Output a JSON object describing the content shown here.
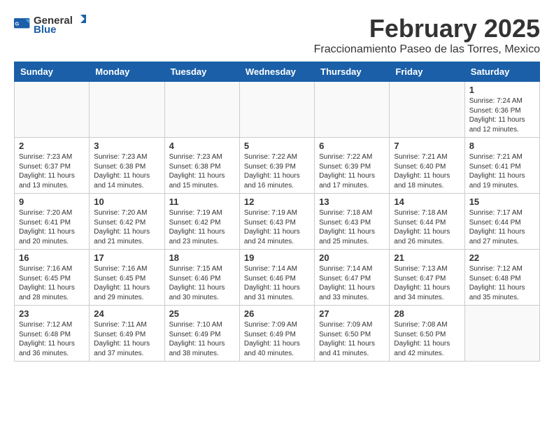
{
  "header": {
    "logo_general": "General",
    "logo_blue": "Blue",
    "month_title": "February 2025",
    "location": "Fraccionamiento Paseo de las Torres, Mexico"
  },
  "weekdays": [
    "Sunday",
    "Monday",
    "Tuesday",
    "Wednesday",
    "Thursday",
    "Friday",
    "Saturday"
  ],
  "weeks": [
    [
      {
        "day": "",
        "info": ""
      },
      {
        "day": "",
        "info": ""
      },
      {
        "day": "",
        "info": ""
      },
      {
        "day": "",
        "info": ""
      },
      {
        "day": "",
        "info": ""
      },
      {
        "day": "",
        "info": ""
      },
      {
        "day": "1",
        "info": "Sunrise: 7:24 AM\nSunset: 6:36 PM\nDaylight: 11 hours and 12 minutes."
      }
    ],
    [
      {
        "day": "2",
        "info": "Sunrise: 7:23 AM\nSunset: 6:37 PM\nDaylight: 11 hours and 13 minutes."
      },
      {
        "day": "3",
        "info": "Sunrise: 7:23 AM\nSunset: 6:38 PM\nDaylight: 11 hours and 14 minutes."
      },
      {
        "day": "4",
        "info": "Sunrise: 7:23 AM\nSunset: 6:38 PM\nDaylight: 11 hours and 15 minutes."
      },
      {
        "day": "5",
        "info": "Sunrise: 7:22 AM\nSunset: 6:39 PM\nDaylight: 11 hours and 16 minutes."
      },
      {
        "day": "6",
        "info": "Sunrise: 7:22 AM\nSunset: 6:39 PM\nDaylight: 11 hours and 17 minutes."
      },
      {
        "day": "7",
        "info": "Sunrise: 7:21 AM\nSunset: 6:40 PM\nDaylight: 11 hours and 18 minutes."
      },
      {
        "day": "8",
        "info": "Sunrise: 7:21 AM\nSunset: 6:41 PM\nDaylight: 11 hours and 19 minutes."
      }
    ],
    [
      {
        "day": "9",
        "info": "Sunrise: 7:20 AM\nSunset: 6:41 PM\nDaylight: 11 hours and 20 minutes."
      },
      {
        "day": "10",
        "info": "Sunrise: 7:20 AM\nSunset: 6:42 PM\nDaylight: 11 hours and 21 minutes."
      },
      {
        "day": "11",
        "info": "Sunrise: 7:19 AM\nSunset: 6:42 PM\nDaylight: 11 hours and 23 minutes."
      },
      {
        "day": "12",
        "info": "Sunrise: 7:19 AM\nSunset: 6:43 PM\nDaylight: 11 hours and 24 minutes."
      },
      {
        "day": "13",
        "info": "Sunrise: 7:18 AM\nSunset: 6:43 PM\nDaylight: 11 hours and 25 minutes."
      },
      {
        "day": "14",
        "info": "Sunrise: 7:18 AM\nSunset: 6:44 PM\nDaylight: 11 hours and 26 minutes."
      },
      {
        "day": "15",
        "info": "Sunrise: 7:17 AM\nSunset: 6:44 PM\nDaylight: 11 hours and 27 minutes."
      }
    ],
    [
      {
        "day": "16",
        "info": "Sunrise: 7:16 AM\nSunset: 6:45 PM\nDaylight: 11 hours and 28 minutes."
      },
      {
        "day": "17",
        "info": "Sunrise: 7:16 AM\nSunset: 6:45 PM\nDaylight: 11 hours and 29 minutes."
      },
      {
        "day": "18",
        "info": "Sunrise: 7:15 AM\nSunset: 6:46 PM\nDaylight: 11 hours and 30 minutes."
      },
      {
        "day": "19",
        "info": "Sunrise: 7:14 AM\nSunset: 6:46 PM\nDaylight: 11 hours and 31 minutes."
      },
      {
        "day": "20",
        "info": "Sunrise: 7:14 AM\nSunset: 6:47 PM\nDaylight: 11 hours and 33 minutes."
      },
      {
        "day": "21",
        "info": "Sunrise: 7:13 AM\nSunset: 6:47 PM\nDaylight: 11 hours and 34 minutes."
      },
      {
        "day": "22",
        "info": "Sunrise: 7:12 AM\nSunset: 6:48 PM\nDaylight: 11 hours and 35 minutes."
      }
    ],
    [
      {
        "day": "23",
        "info": "Sunrise: 7:12 AM\nSunset: 6:48 PM\nDaylight: 11 hours and 36 minutes."
      },
      {
        "day": "24",
        "info": "Sunrise: 7:11 AM\nSunset: 6:49 PM\nDaylight: 11 hours and 37 minutes."
      },
      {
        "day": "25",
        "info": "Sunrise: 7:10 AM\nSunset: 6:49 PM\nDaylight: 11 hours and 38 minutes."
      },
      {
        "day": "26",
        "info": "Sunrise: 7:09 AM\nSunset: 6:49 PM\nDaylight: 11 hours and 40 minutes."
      },
      {
        "day": "27",
        "info": "Sunrise: 7:09 AM\nSunset: 6:50 PM\nDaylight: 11 hours and 41 minutes."
      },
      {
        "day": "28",
        "info": "Sunrise: 7:08 AM\nSunset: 6:50 PM\nDaylight: 11 hours and 42 minutes."
      },
      {
        "day": "",
        "info": ""
      }
    ]
  ]
}
